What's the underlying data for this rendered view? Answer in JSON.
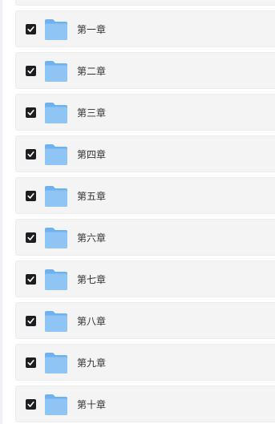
{
  "folders": [
    {
      "name": "",
      "checked": true
    },
    {
      "name": "第一章",
      "checked": true
    },
    {
      "name": "第二章",
      "checked": true
    },
    {
      "name": "第三章",
      "checked": true
    },
    {
      "name": "第四章",
      "checked": true
    },
    {
      "name": "第五章",
      "checked": true
    },
    {
      "name": "第六章",
      "checked": true
    },
    {
      "name": "第七章",
      "checked": true
    },
    {
      "name": "第八章",
      "checked": true
    },
    {
      "name": "第九章",
      "checked": true
    },
    {
      "name": "第十章",
      "checked": true
    }
  ],
  "icons": {
    "checkbox": "checkbox-checked-icon",
    "folder": "folder-icon"
  },
  "colors": {
    "row_background": "#f4f4f5",
    "checkbox_fill": "#1e1e20",
    "folder_front": "#8ec5f5",
    "folder_back": "#6fb2ef"
  }
}
